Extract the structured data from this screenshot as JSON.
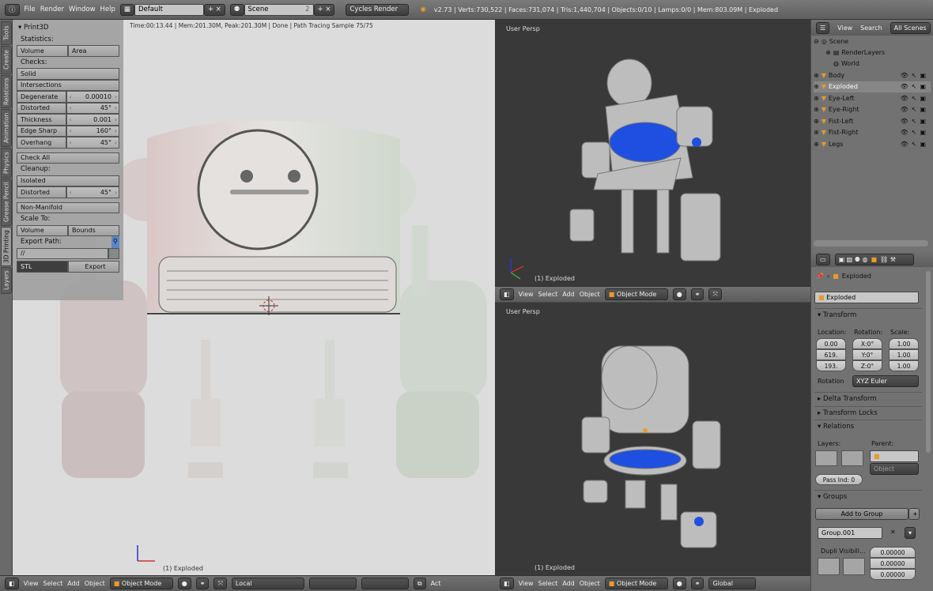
{
  "topbar": {
    "menus": [
      "File",
      "Render",
      "Window",
      "Help"
    ],
    "layout": "Default",
    "scene": "Scene",
    "scene_users": "2",
    "engine": "Cycles Render",
    "stats": "v2.73 | Verts:730,522 | Faces:731,074 | Tris:1,440,704 | Objects:0/10 | Lamps:0/0 | Mem:803.09M | Exploded"
  },
  "tool_tabs": [
    "Tools",
    "Create",
    "Relations",
    "Animation",
    "Physics",
    "Grease Pencil",
    "3D Printing",
    "Layers"
  ],
  "render_view": {
    "status": "Time:00:13.44 | Mem:201.30M, Peak:201.30M | Done | Path Tracing Sample 75/75",
    "footer": "(1) Exploded"
  },
  "print3d": {
    "title": "Print3D",
    "statistics": "Statistics:",
    "stat_buttons": [
      "Volume",
      "Area"
    ],
    "checks": "Checks:",
    "solid": "Solid",
    "intersections": "Intersections",
    "params": [
      {
        "label": "Degenerate",
        "value": "0.00010"
      },
      {
        "label": "Distorted",
        "value": "45°"
      },
      {
        "label": "Thickness",
        "value": "0.001"
      },
      {
        "label": "Edge Sharp",
        "value": "160°"
      },
      {
        "label": "Overhang",
        "value": "45°"
      }
    ],
    "check_all": "Check All",
    "cleanup": "Cleanup:",
    "isolated": "Isolated",
    "cleanup_distorted": {
      "label": "Distorted",
      "value": "45°"
    },
    "non_manifold": "Non-Manifold",
    "scale_to": "Scale To:",
    "scale_buttons": [
      "Volume",
      "Bounds"
    ],
    "export_path_label": "Export Path:",
    "export_path": "//",
    "format": "STL",
    "export": "Export"
  },
  "viewport_header_left": {
    "menus": [
      "View",
      "Select",
      "Add",
      "Object"
    ],
    "mode": "Object Mode",
    "orientation": "Local",
    "extra": "Act"
  },
  "viewport_top": {
    "title": "User Persp",
    "footer": "(1) Exploded",
    "menus": [
      "View",
      "Select",
      "Add",
      "Object"
    ],
    "mode": "Object Mode"
  },
  "viewport_bottom": {
    "title": "User Persp",
    "footer": "(1) Exploded",
    "menus": [
      "View",
      "Select",
      "Add",
      "Object"
    ],
    "mode": "Object Mode",
    "orientation": "Global"
  },
  "outliner": {
    "menus": [
      "View",
      "Search"
    ],
    "filter": "All Scenes",
    "scene": "Scene",
    "render_layers": "RenderLayers",
    "world": "World",
    "objects": [
      "Body",
      "Exploded",
      "Eye-Left",
      "Eye-Right",
      "Fist-Left",
      "Fist-Right",
      "Legs"
    ],
    "selected": "Exploded"
  },
  "properties": {
    "breadcrumb": "Exploded",
    "object_name": "Exploded",
    "transform": "Transform",
    "location_label": "Location:",
    "rotation_label": "Rotation:",
    "scale_label": "Scale:",
    "location": [
      "0.00",
      "619.",
      "193."
    ],
    "rotation": [
      "X:0°",
      "Y:0°",
      "Z:0°"
    ],
    "scale": [
      "1.00",
      "1.00",
      "1.00"
    ],
    "rotation_mode_label": "Rotation",
    "rotation_mode": "XYZ Euler",
    "delta": "Delta Transform",
    "locks": "Transform Locks",
    "relations": "Relations",
    "layers_label": "Layers:",
    "parent_label": "Parent:",
    "parent_type": "Object",
    "pass_index": "Pass Ind: 0",
    "groups": "Groups",
    "add_to_group": "Add to Group",
    "group_name": "Group.001",
    "dupli": "Dupli Visibili...",
    "dupli_offset": [
      "0.00000",
      "0.00000",
      "0.00000"
    ]
  },
  "colors": {
    "accent_blue": "#1f4fe0",
    "selected_text": "#ffffff",
    "object_icon": "#e89a2c"
  }
}
